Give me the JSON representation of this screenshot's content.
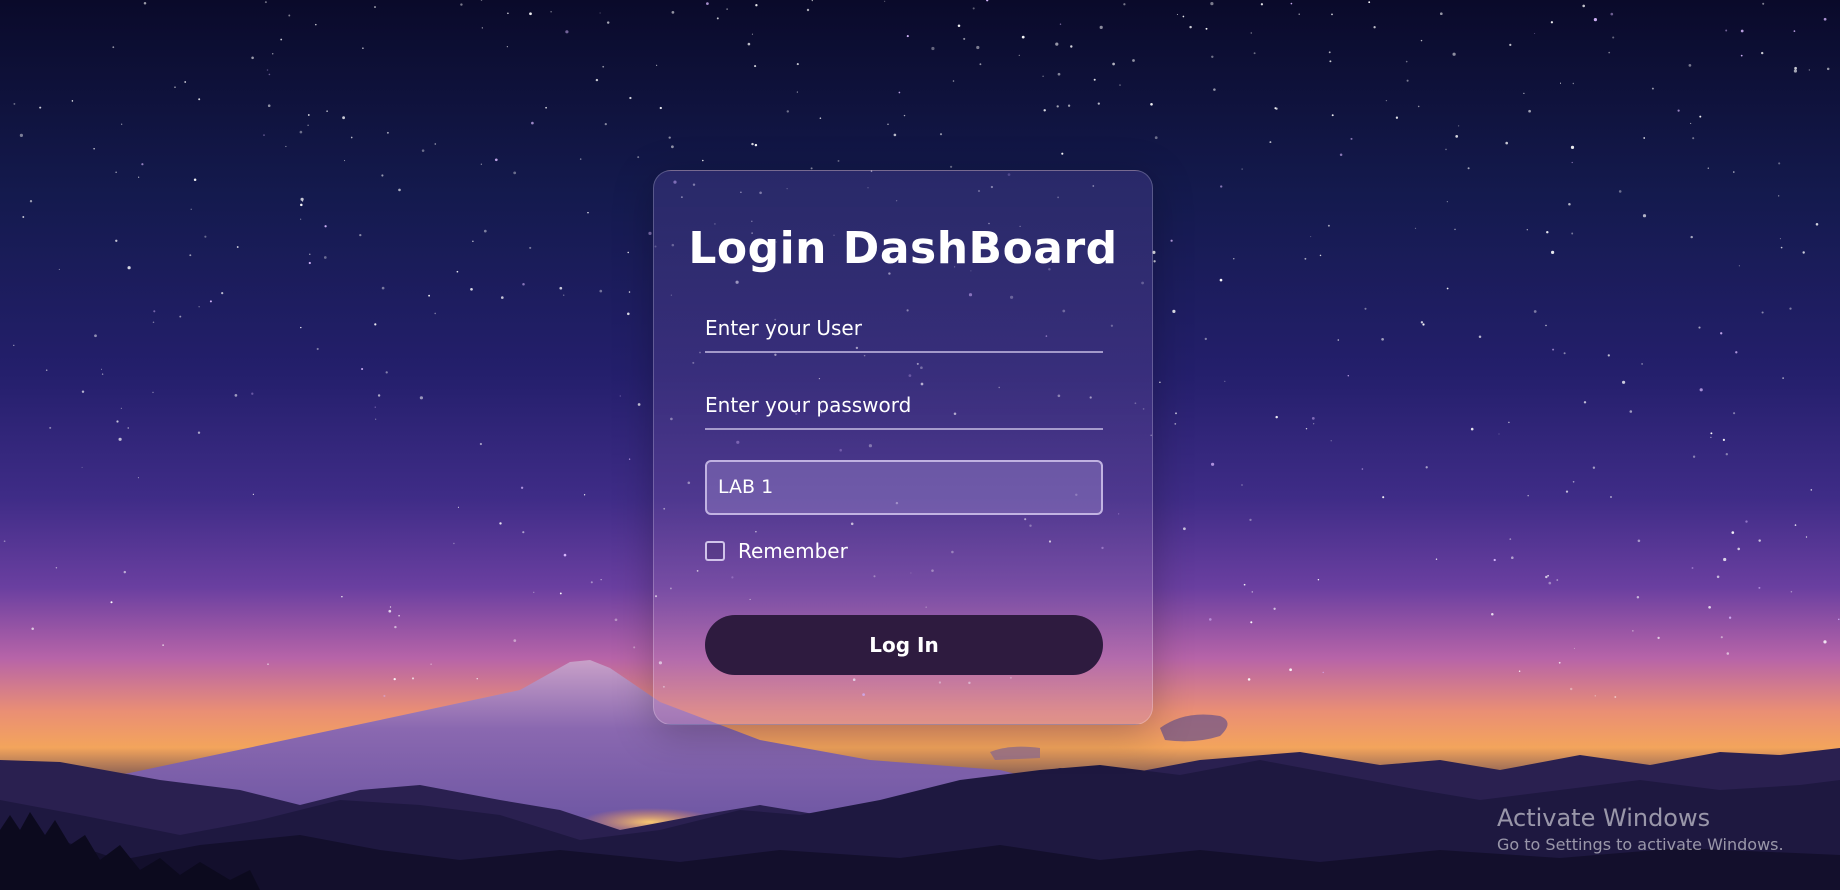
{
  "login_card": {
    "title": "Login DashBoard",
    "user_placeholder": "Enter your User",
    "password_placeholder": "Enter your password",
    "lab_select_value": "LAB 1",
    "remember_label": "Remember",
    "login_button_label": "Log In"
  },
  "watermark": {
    "title": "Activate Windows",
    "subtitle": "Go to Settings to activate Windows."
  },
  "colors": {
    "button_bg": "#2e1b3f",
    "text": "#ffffff"
  }
}
